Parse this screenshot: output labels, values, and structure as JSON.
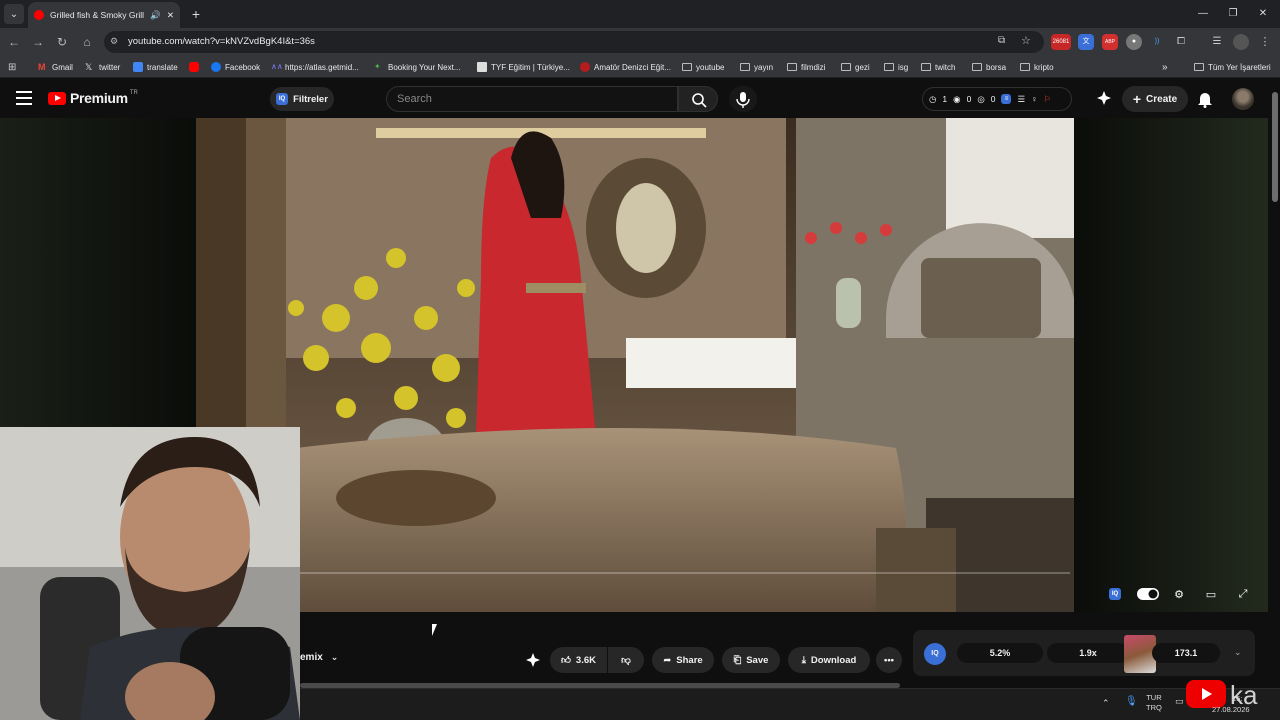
{
  "browser": {
    "tab_title": "Grilled fish & Smoky Grilled",
    "url": "youtube.com/watch?v=kNVZvdBgK4I&t=36s",
    "extension_badge": "26081",
    "extension_label_2": "ABP",
    "bookmarks": [
      {
        "label": "Gmail",
        "icon": "gmail-icon"
      },
      {
        "label": "twitter",
        "icon": "x-icon"
      },
      {
        "label": "translate",
        "icon": "translate-icon"
      },
      {
        "label": "",
        "icon": "youtube-icon"
      },
      {
        "label": "Facebook",
        "icon": "facebook-icon"
      },
      {
        "label": "https://atlas.getmid...",
        "icon": "atlas-icon"
      },
      {
        "label": "Booking Your Next...",
        "icon": "booking-icon"
      },
      {
        "label": "TYF Eğitim | Türkiye...",
        "icon": "doc-icon"
      },
      {
        "label": "Amatör Denizci Eğit...",
        "icon": "sail-icon"
      },
      {
        "label": "youtube",
        "icon": "folder-icon"
      },
      {
        "label": "yayın",
        "icon": "folder-icon"
      },
      {
        "label": "filmdizi",
        "icon": "folder-icon"
      },
      {
        "label": "gezi",
        "icon": "folder-icon"
      },
      {
        "label": "isg",
        "icon": "folder-icon"
      },
      {
        "label": "twitch",
        "icon": "folder-icon"
      },
      {
        "label": "borsa",
        "icon": "folder-icon"
      },
      {
        "label": "kripto",
        "icon": "folder-icon"
      }
    ],
    "all_bookmarks": "Tüm Yer İşaretleri"
  },
  "youtube": {
    "logo_text": "Premium",
    "region": "TR",
    "filters_label": "Filtreler",
    "search_placeholder": "Search",
    "stats": {
      "a": "1",
      "b": "0",
      "c": "0"
    },
    "create_label": "Create"
  },
  "actions": {
    "remix": "emix",
    "likes": "3.6K",
    "share": "Share",
    "save": "Save",
    "download": "Download"
  },
  "iq_panel": {
    "percent": "5.2%",
    "speed": "1.9x",
    "score": "173.1"
  },
  "taskbar": {
    "lang_top": "TUR",
    "lang_bottom": "TRQ",
    "time": "15:",
    "date": "27.08.2026"
  },
  "watermark": "ka",
  "colors": {
    "accent": "#ff0000",
    "iq_blue": "#3b6fd8",
    "bg": "#0f0f0f"
  }
}
